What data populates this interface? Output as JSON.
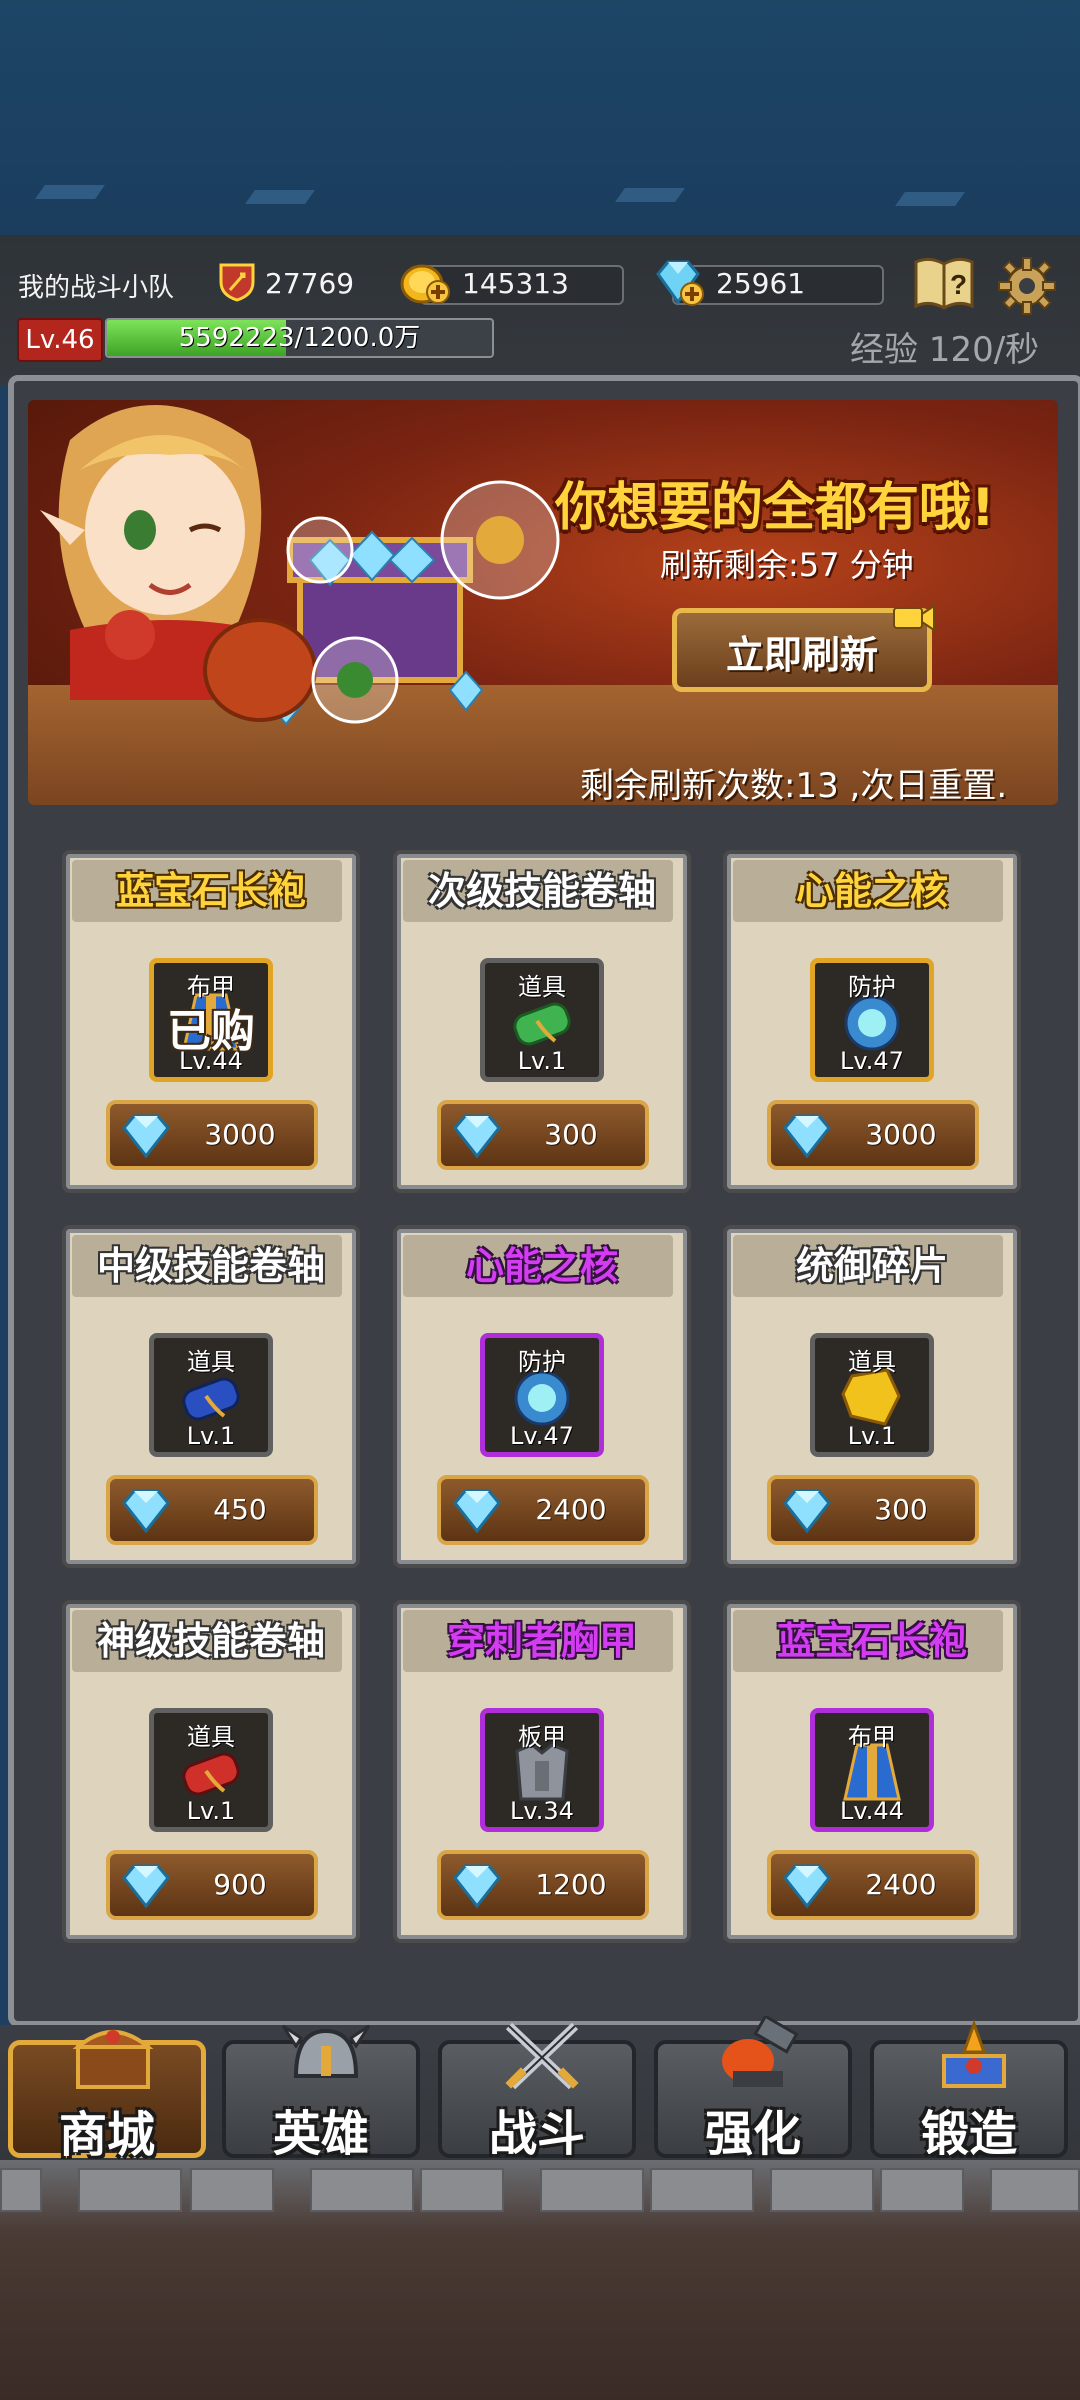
{
  "header": {
    "team_name": "我的战斗小队",
    "power": "27769",
    "gold": "145313",
    "gems": "25961",
    "level": "Lv.46",
    "xp_text": "5592223/1200.0万",
    "xp_fraction": 0.466,
    "xp_rate": "经验 120/秒"
  },
  "banner": {
    "title": "你想要的全都有哦!",
    "timer": "刷新剩余:57 分钟",
    "refresh_button": "立即刷新",
    "refresh_count": "剩余刷新次数:13 ,次日重置."
  },
  "shop": {
    "items": [
      {
        "name": "蓝宝石长袍",
        "name_color": "yellow",
        "quality": "gold",
        "type": "布甲",
        "level": "Lv.44",
        "price": "3000",
        "icon": "robe-icon",
        "bought_label": "已购"
      },
      {
        "name": "次级技能卷轴",
        "name_color": "white",
        "quality": "gray",
        "type": "道具",
        "level": "Lv.1",
        "price": "300",
        "icon": "green-scroll-icon"
      },
      {
        "name": "心能之核",
        "name_color": "yellow",
        "quality": "gold",
        "type": "防护",
        "level": "Lv.47",
        "price": "3000",
        "icon": "orb-icon"
      },
      {
        "name": "中级技能卷轴",
        "name_color": "white",
        "quality": "gray",
        "type": "道具",
        "level": "Lv.1",
        "price": "450",
        "icon": "blue-scroll-icon"
      },
      {
        "name": "心能之核",
        "name_color": "purple",
        "quality": "purple",
        "type": "防护",
        "level": "Lv.47",
        "price": "2400",
        "icon": "orb-icon"
      },
      {
        "name": "统御碎片",
        "name_color": "white",
        "quality": "gray",
        "type": "道具",
        "level": "Lv.1",
        "price": "300",
        "icon": "gold-shard-icon"
      },
      {
        "name": "神级技能卷轴",
        "name_color": "white",
        "quality": "gray",
        "type": "道具",
        "level": "Lv.1",
        "price": "900",
        "icon": "red-scroll-icon"
      },
      {
        "name": "穿刺者胸甲",
        "name_color": "purple",
        "quality": "purple",
        "type": "板甲",
        "level": "Lv.34",
        "price": "1200",
        "icon": "chestplate-icon"
      },
      {
        "name": "蓝宝石长袍",
        "name_color": "purple",
        "quality": "purple",
        "type": "布甲",
        "level": "Lv.44",
        "price": "2400",
        "icon": "robe-icon"
      }
    ]
  },
  "nav": {
    "tabs": [
      {
        "label": "商城",
        "icon": "treasure-chest-icon",
        "active": true
      },
      {
        "label": "英雄",
        "icon": "helmet-icon",
        "active": false
      },
      {
        "label": "战斗",
        "icon": "crossed-swords-icon",
        "active": false
      },
      {
        "label": "强化",
        "icon": "anvil-hammer-icon",
        "active": false
      },
      {
        "label": "锻造",
        "icon": "forge-icon",
        "active": false
      }
    ]
  },
  "colors": {
    "accent_gold": "#e3a93a",
    "purple_quality": "#b02ed9",
    "gold_quality": "#e0a526",
    "xp_green": "#5cc83c"
  }
}
